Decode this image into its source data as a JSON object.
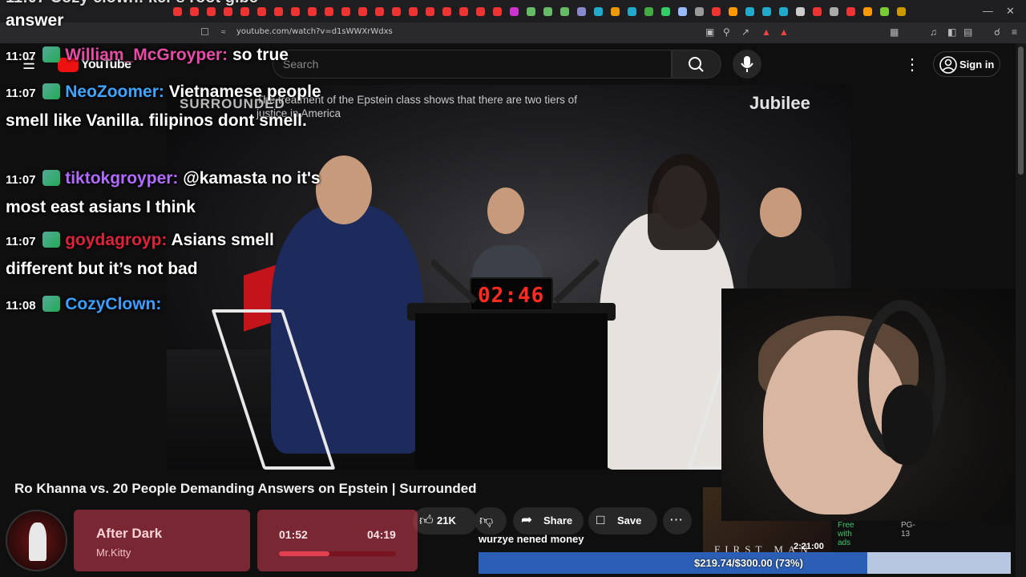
{
  "browser": {
    "url": "youtube.com/watch?v=d1sWWXrWdxs"
  },
  "youtube": {
    "logo_text": "YouTube",
    "search_placeholder": "Search",
    "signin_label": "Sign in"
  },
  "video": {
    "caption": "The treatment of the Epstein class shows that there are two tiers of justice in America",
    "surround_logo": "SURROUNDED",
    "brand": "Jubilee",
    "timer": "02:46",
    "title": "Ro Khanna vs. 20 People Demanding Answers on Epstein | Surrounded",
    "like_count": "21K",
    "share_label": "Share",
    "save_label": "Save"
  },
  "chat": {
    "top_cut_text": "11:07 Cozy clown: ker's root gibe",
    "top_answer_text": "answer",
    "messages": [
      {
        "time": "11:07",
        "user": "William_McGroyper:",
        "text": "so true",
        "color": "#e84ca8"
      },
      {
        "time": "11:07",
        "user": "NeoZoomer:",
        "text": "Vietnamese people smell like Vanilla. filipinos dont smell.",
        "color": "#3ea6ff"
      },
      {
        "time": "11:07",
        "user": "tiktokgroyper:",
        "text": "@kamasta no it's most east asians I think",
        "color": "#b36bff"
      },
      {
        "time": "11:07",
        "user": "goydagroyp:",
        "text": "Asians smell different but it’s not bad",
        "color": "#e0213b"
      },
      {
        "time": "11:08",
        "user": "CozyClown:",
        "text": "",
        "color": "#3aa0ff"
      }
    ]
  },
  "sidebar": {
    "badge_free": "Free with ads",
    "badge_rating": "PG-13",
    "duration": "2:21:00",
    "thumb_text": "FIRST MAN"
  },
  "stream": {
    "donor_message": "wurzye nened money",
    "goal_label": "$219.74/$300.00 (73%)",
    "goal_fraction": 0.73
  },
  "music": {
    "title": "After Dark",
    "artist": "Mr.Kitty",
    "elapsed": "01:52",
    "total": "04:19",
    "progress_fraction": 0.43
  },
  "colors": {
    "accent_red": "#ff2a20",
    "goal_fill": "#2b5fb5"
  }
}
